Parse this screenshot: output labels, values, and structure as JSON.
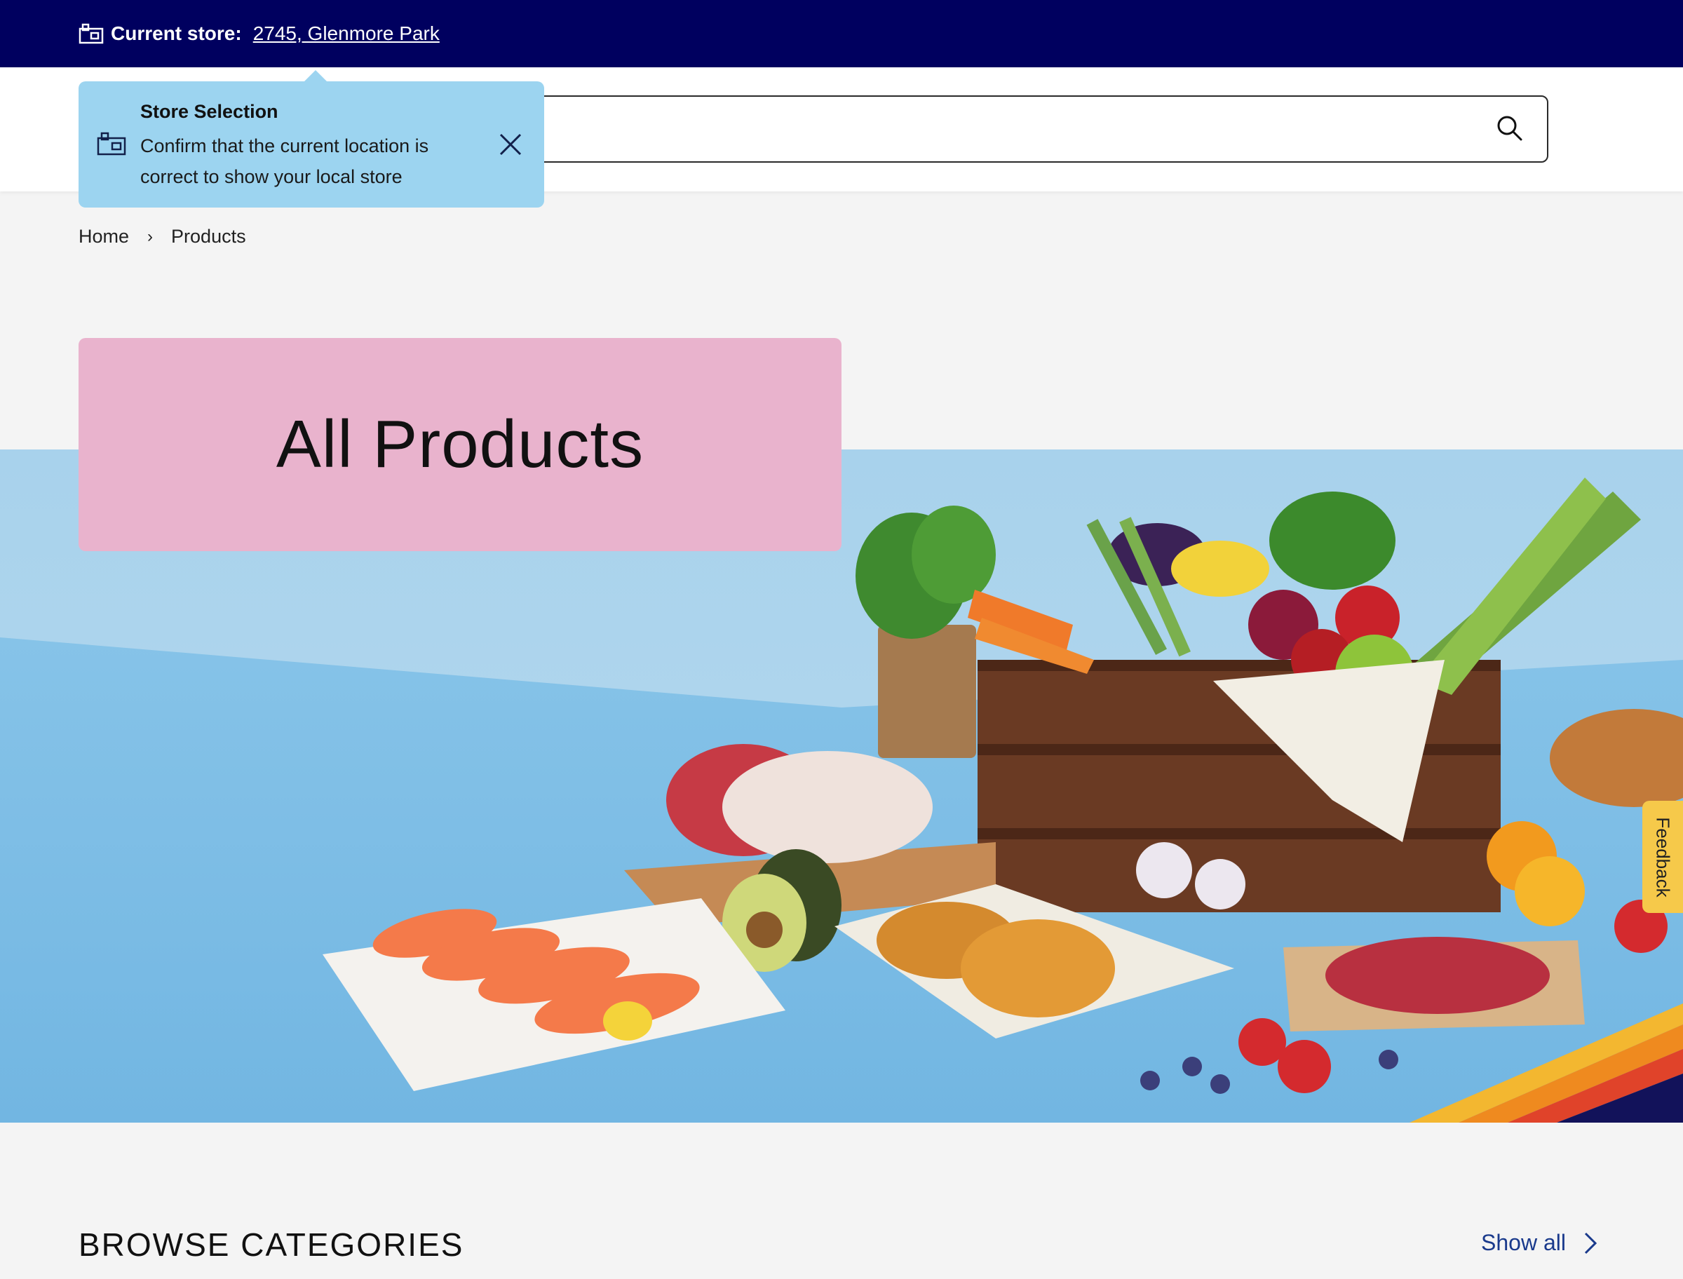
{
  "store_bar": {
    "label": "Current store:",
    "store_link": "2745, Glenmore Park"
  },
  "search": {
    "value": "",
    "placeholder": ""
  },
  "tooltip": {
    "title": "Store Selection",
    "body": "Confirm that the current location is correct to show your local store"
  },
  "breadcrumb": {
    "items": [
      "Home",
      "Products"
    ],
    "separator": "›"
  },
  "hero": {
    "title": "All Products"
  },
  "feedback": {
    "label": "Feedback"
  },
  "browse": {
    "title": "BROWSE CATEGORIES",
    "show_all": "Show all"
  },
  "colors": {
    "top_bar": "#00005f",
    "tooltip": "#9cd4f0",
    "title_card": "#e9b3cd",
    "hero_sky": "#a8d2ec",
    "hero_table": "#7fbfe6",
    "feedback": "#f6c94a",
    "link": "#1a3a8c"
  },
  "icons": {
    "store": "store-icon",
    "search": "search-icon",
    "close": "close-icon",
    "chevron": "chevron-right-icon"
  }
}
